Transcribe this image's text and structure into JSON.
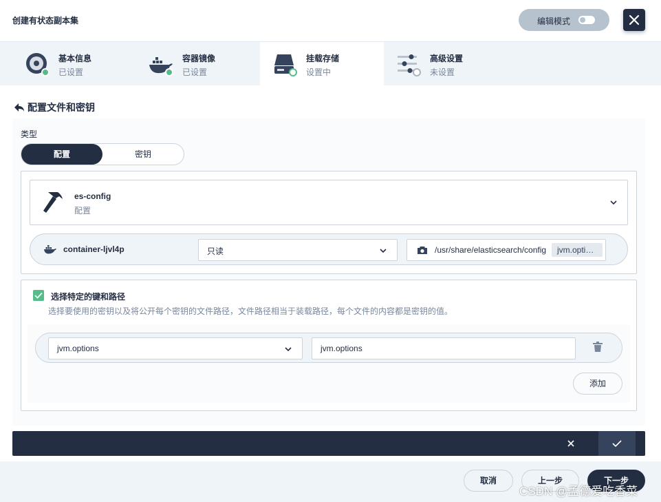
{
  "header": {
    "title": "创建有状态副本集",
    "edit_mode_label": "编辑模式"
  },
  "steps": [
    {
      "name": "基本信息",
      "status": "已设置"
    },
    {
      "name": "容器镜像",
      "status": "已设置"
    },
    {
      "name": "挂载存储",
      "status": "设置中"
    },
    {
      "name": "高级设置",
      "status": "未设置"
    }
  ],
  "config": {
    "back_title": "配置文件和密钥",
    "type_label": "类型",
    "type_options": [
      "配置",
      "密钥"
    ],
    "selected_type": "配置",
    "resource": {
      "name": "es-config",
      "type": "配置"
    },
    "mount": {
      "container": "container-ljvl4p",
      "mode": "只读",
      "path": "/usr/share/elasticsearch/config",
      "path_tag": "jvm.options"
    },
    "specific_keys": {
      "checked": true,
      "label": "选择特定的键和路径",
      "description": "选择要使用的密钥以及将公开每个密钥的文件路径，文件路径相当于装载路径，每个文件的内容都是密钥的值。",
      "rows": [
        {
          "key": "jvm.options",
          "path": "jvm.options"
        }
      ],
      "add_label": "添加"
    }
  },
  "footer": {
    "cancel": "取消",
    "prev": "上一步",
    "next": "下一步",
    "watermark": "CSDN @孟德爱吃香菜"
  },
  "colors": {
    "primary": "#242e42",
    "success": "#55bc8a",
    "background": "#eff4f9"
  }
}
